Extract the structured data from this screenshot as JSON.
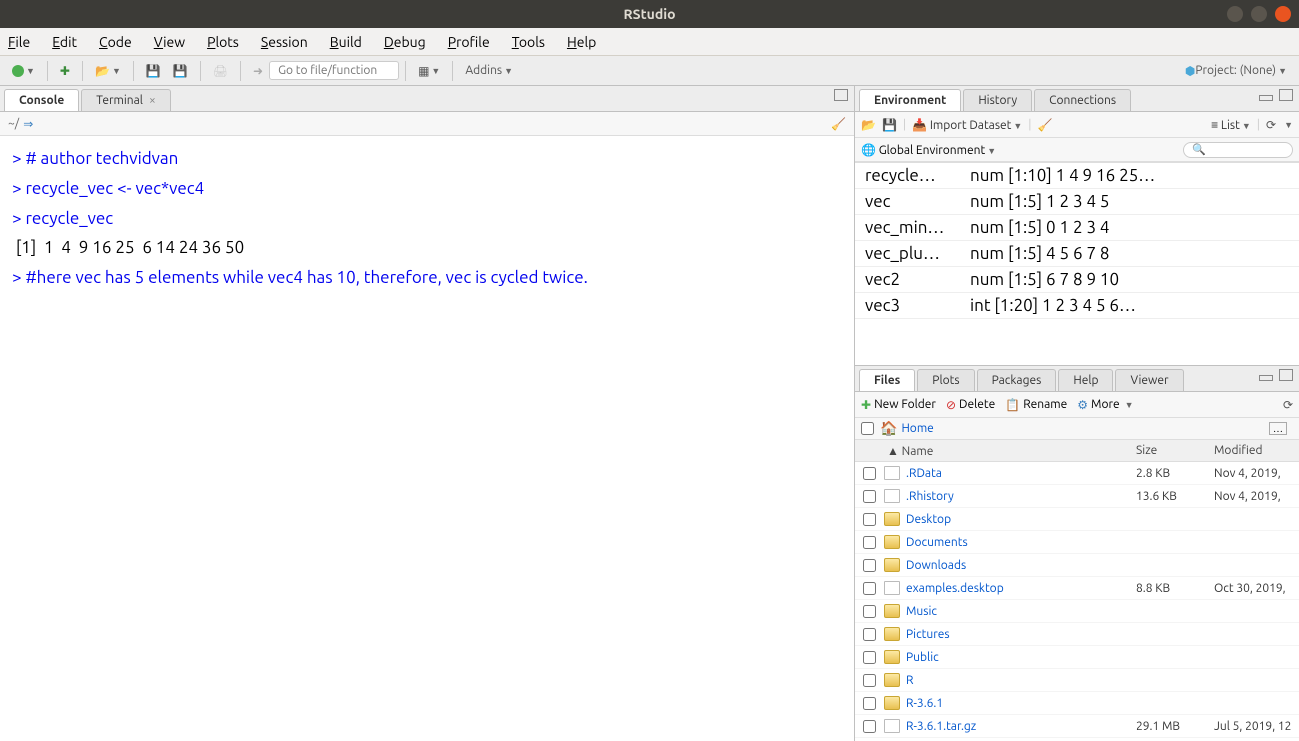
{
  "window": {
    "title": "RStudio"
  },
  "menu": {
    "file": "File",
    "edit": "Edit",
    "code": "Code",
    "view": "View",
    "plots": "Plots",
    "session": "Session",
    "build": "Build",
    "debug": "Debug",
    "profile": "Profile",
    "tools": "Tools",
    "help": "Help"
  },
  "toolbar": {
    "goto_placeholder": "Go to file/function",
    "addins": "Addins",
    "project_label": "Project: (None)"
  },
  "left": {
    "tabs": {
      "console": "Console",
      "terminal": "Terminal"
    },
    "path": "~/",
    "console_lines": [
      {
        "type": "prompt",
        "text": "> # author techvidvan"
      },
      {
        "type": "prompt",
        "text": "> recycle_vec <- vec*vec4"
      },
      {
        "type": "prompt",
        "text": "> recycle_vec"
      },
      {
        "type": "output",
        "text": " [1]  1  4  9 16 25  6 14 24 36 50"
      },
      {
        "type": "prompt",
        "text": "> #here vec has 5 elements while vec4 has 10, therefore, vec is cycled twice."
      }
    ]
  },
  "env_panel": {
    "tabs": {
      "environment": "Environment",
      "history": "History",
      "connections": "Connections"
    },
    "import": "Import Dataset",
    "view_mode": "List",
    "scope": "Global Environment",
    "vars": [
      {
        "name": "recycle…",
        "value": "num [1:10] 1 4 9 16 25…"
      },
      {
        "name": "vec",
        "value": "num [1:5] 1 2 3 4 5"
      },
      {
        "name": "vec_min…",
        "value": "num [1:5] 0 1 2 3 4"
      },
      {
        "name": "vec_plu…",
        "value": "num [1:5] 4 5 6 7 8"
      },
      {
        "name": "vec2",
        "value": "num [1:5] 6 7 8 9 10"
      },
      {
        "name": "vec3",
        "value": "int [1:20] 1 2 3 4 5 6…"
      }
    ]
  },
  "files_panel": {
    "tabs": {
      "files": "Files",
      "plots": "Plots",
      "packages": "Packages",
      "help": "Help",
      "viewer": "Viewer"
    },
    "actions": {
      "new_folder": "New Folder",
      "delete": "Delete",
      "rename": "Rename",
      "more": "More"
    },
    "breadcrumb": "Home",
    "headers": {
      "name": "Name",
      "size": "Size",
      "modified": "Modified"
    },
    "files": [
      {
        "icon": "doc",
        "name": ".RData",
        "size": "2.8 KB",
        "modified": "Nov 4, 2019,"
      },
      {
        "icon": "doc",
        "name": ".Rhistory",
        "size": "13.6 KB",
        "modified": "Nov 4, 2019,"
      },
      {
        "icon": "folder",
        "name": "Desktop",
        "size": "",
        "modified": ""
      },
      {
        "icon": "folder",
        "name": "Documents",
        "size": "",
        "modified": ""
      },
      {
        "icon": "folder",
        "name": "Downloads",
        "size": "",
        "modified": ""
      },
      {
        "icon": "doc",
        "name": "examples.desktop",
        "size": "8.8 KB",
        "modified": "Oct 30, 2019,"
      },
      {
        "icon": "folder",
        "name": "Music",
        "size": "",
        "modified": ""
      },
      {
        "icon": "folder",
        "name": "Pictures",
        "size": "",
        "modified": ""
      },
      {
        "icon": "folder",
        "name": "Public",
        "size": "",
        "modified": ""
      },
      {
        "icon": "folder",
        "name": "R",
        "size": "",
        "modified": ""
      },
      {
        "icon": "folder",
        "name": "R-3.6.1",
        "size": "",
        "modified": ""
      },
      {
        "icon": "doc",
        "name": "R-3.6.1.tar.gz",
        "size": "29.1 MB",
        "modified": "Jul 5, 2019, 12"
      }
    ]
  }
}
